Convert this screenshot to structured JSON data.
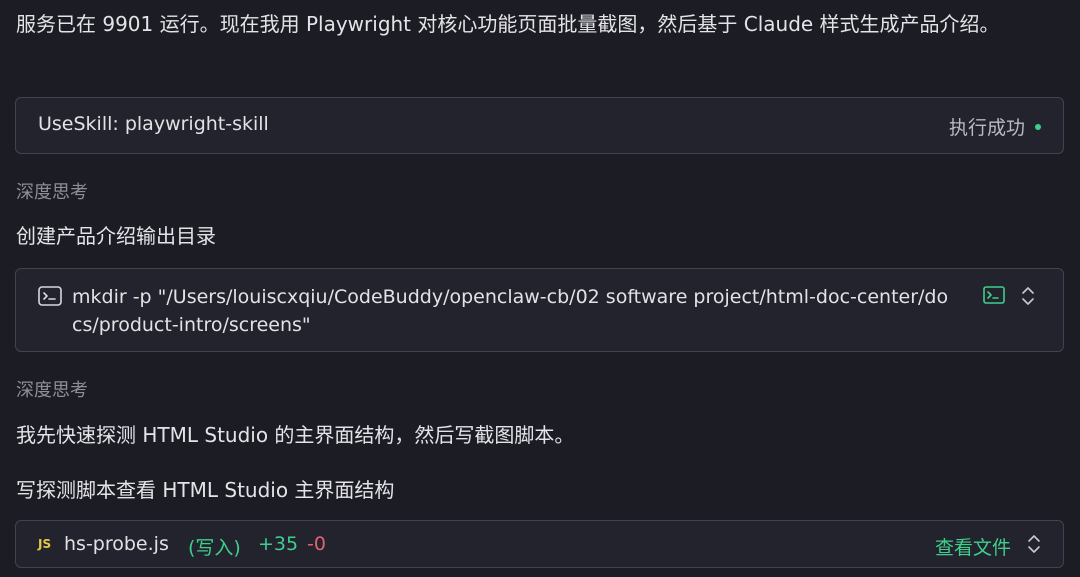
{
  "intro_text": "服务已在 9901 运行。现在我用 Playwright 对核心功能页面批量截图，然后基于 Claude 样式生成产品介绍。",
  "tool_call": {
    "label": "UseSkill: playwright-skill",
    "status": "执行成功",
    "status_color": "#3ecf8e"
  },
  "thinking_label_1": "深度思考",
  "step_1_title": "创建产品介绍输出目录",
  "command": {
    "icon": "terminal-icon",
    "text": "mkdir -p \"/Users/louiscxqiu/CodeBuddy/openclaw-cb/02 software project/html-doc-center/docs/product-intro/screens\""
  },
  "thinking_label_2": "深度思考",
  "step_2_text": "我先快速探测 HTML Studio 的主界面结构，然后写截图脚本。",
  "step_3_title": "写探测脚本查看 HTML Studio 主界面结构",
  "file_card": {
    "badge": "JS",
    "file_name": "hs-probe.js",
    "action": "(写入)",
    "additions": "+35",
    "deletions": "-0",
    "view_label": "查看文件"
  },
  "colors": {
    "background": "#1c1c25",
    "card_bg": "#23232d",
    "border": "#43434f",
    "accent_green": "#3ecf8e",
    "delete_red": "#e06470",
    "js_yellow": "#e3c84a"
  }
}
